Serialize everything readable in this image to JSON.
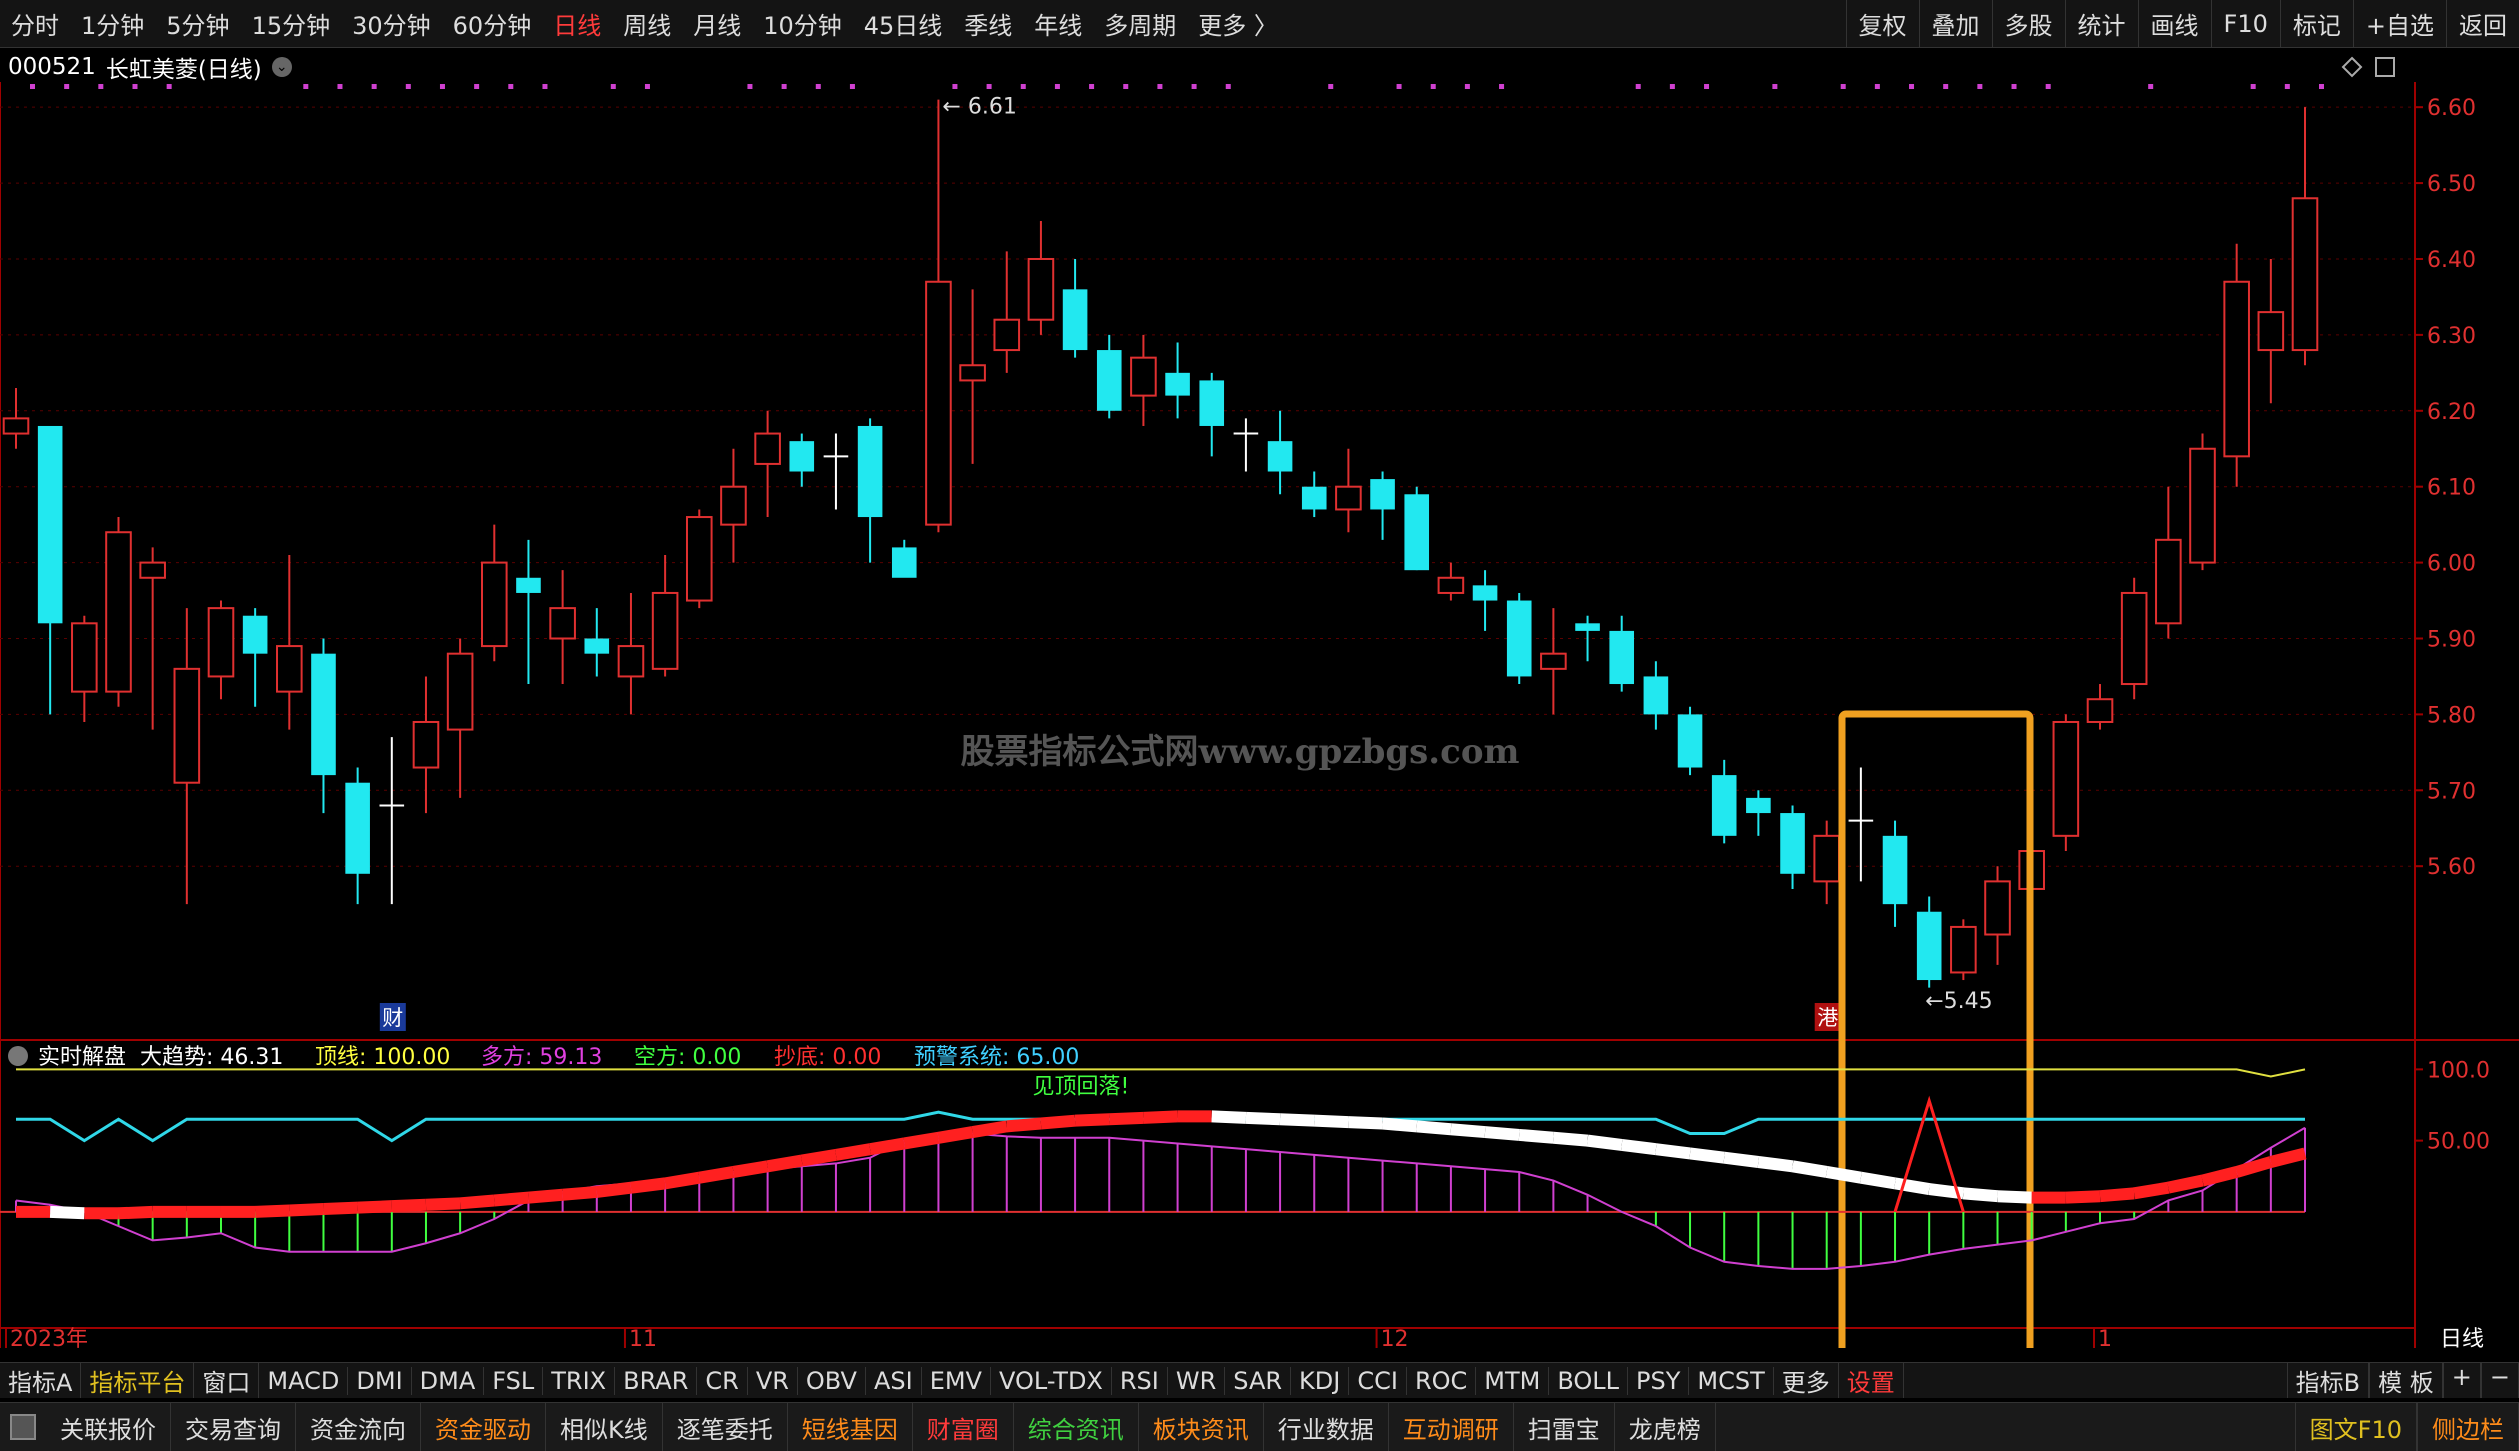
{
  "topbar": {
    "periods": [
      "分时",
      "1分钟",
      "5分钟",
      "15分钟",
      "30分钟",
      "60分钟",
      "日线",
      "周线",
      "月线",
      "10分钟",
      "45日线",
      "季线",
      "年线",
      "多周期",
      "更多 〉"
    ],
    "active_index": 6,
    "right_items": [
      "复权",
      "叠加",
      "多股",
      "统计",
      "画线",
      "F10",
      "标记",
      "+自选",
      "返回"
    ]
  },
  "stock": {
    "code": "000521",
    "name": "长虹美菱(日线)"
  },
  "watermark": "股票指标公式网www.gpzbgs.com",
  "chart_data": {
    "type": "candlestick",
    "y_ticks": [
      5.6,
      5.7,
      5.8,
      5.9,
      6.0,
      6.1,
      6.2,
      6.3,
      6.4,
      6.5,
      6.6
    ],
    "ylim": [
      5.4,
      6.62
    ],
    "high_label": "6.61",
    "low_label": "5.45",
    "date_labels": [
      {
        "index": 0,
        "text": "2023年"
      },
      {
        "index": 18,
        "text": "11"
      },
      {
        "index": 40,
        "text": "12"
      },
      {
        "index": 61,
        "text": "1"
      }
    ],
    "period_label": "日线",
    "event_markers": [
      {
        "index": 11,
        "text": "财"
      },
      {
        "index": 53,
        "text": "港"
      }
    ],
    "colors": {
      "up": "#e03030",
      "down": "#22e8f0",
      "flat": "#ffffff",
      "grid": "#5a0000"
    },
    "candles": [
      [
        6.17,
        6.19,
        6.23,
        6.15
      ],
      [
        6.18,
        5.92,
        6.18,
        5.8
      ],
      [
        5.83,
        5.92,
        5.93,
        5.79
      ],
      [
        5.83,
        6.04,
        6.06,
        5.81
      ],
      [
        5.98,
        6.0,
        6.02,
        5.78
      ],
      [
        5.71,
        5.86,
        5.94,
        5.55
      ],
      [
        5.85,
        5.94,
        5.95,
        5.82
      ],
      [
        5.93,
        5.88,
        5.94,
        5.81
      ],
      [
        5.83,
        5.89,
        6.01,
        5.78
      ],
      [
        5.88,
        5.72,
        5.9,
        5.67
      ],
      [
        5.71,
        5.59,
        5.73,
        5.55
      ],
      [
        5.68,
        5.68,
        5.77,
        5.55
      ],
      [
        5.73,
        5.79,
        5.85,
        5.67
      ],
      [
        5.78,
        5.88,
        5.9,
        5.69
      ],
      [
        5.89,
        6.0,
        6.05,
        5.87
      ],
      [
        5.98,
        5.96,
        6.03,
        5.84
      ],
      [
        5.9,
        5.94,
        5.99,
        5.84
      ],
      [
        5.9,
        5.88,
        5.94,
        5.85
      ],
      [
        5.85,
        5.89,
        5.96,
        5.8
      ],
      [
        5.86,
        5.96,
        6.01,
        5.85
      ],
      [
        5.95,
        6.06,
        6.07,
        5.94
      ],
      [
        6.05,
        6.1,
        6.15,
        6.0
      ],
      [
        6.13,
        6.17,
        6.2,
        6.06
      ],
      [
        6.16,
        6.12,
        6.17,
        6.1
      ],
      [
        6.14,
        6.14,
        6.17,
        6.07
      ],
      [
        6.18,
        6.06,
        6.19,
        6.0
      ],
      [
        6.02,
        5.98,
        6.03,
        5.99
      ],
      [
        6.05,
        6.37,
        6.61,
        6.04
      ],
      [
        6.24,
        6.26,
        6.36,
        6.13
      ],
      [
        6.28,
        6.32,
        6.41,
        6.25
      ],
      [
        6.32,
        6.4,
        6.45,
        6.3
      ],
      [
        6.36,
        6.28,
        6.4,
        6.27
      ],
      [
        6.28,
        6.2,
        6.3,
        6.19
      ],
      [
        6.22,
        6.27,
        6.3,
        6.18
      ],
      [
        6.25,
        6.22,
        6.29,
        6.19
      ],
      [
        6.24,
        6.18,
        6.25,
        6.14
      ],
      [
        6.17,
        6.17,
        6.19,
        6.12
      ],
      [
        6.16,
        6.12,
        6.2,
        6.09
      ],
      [
        6.1,
        6.07,
        6.12,
        6.06
      ],
      [
        6.07,
        6.1,
        6.15,
        6.04
      ],
      [
        6.11,
        6.07,
        6.12,
        6.03
      ],
      [
        6.09,
        5.99,
        6.1,
        5.99
      ],
      [
        5.96,
        5.98,
        6.0,
        5.95
      ],
      [
        5.97,
        5.95,
        5.99,
        5.91
      ],
      [
        5.95,
        5.85,
        5.96,
        5.84
      ],
      [
        5.86,
        5.88,
        5.94,
        5.8
      ],
      [
        5.92,
        5.91,
        5.93,
        5.87
      ],
      [
        5.91,
        5.84,
        5.93,
        5.83
      ],
      [
        5.85,
        5.8,
        5.87,
        5.78
      ],
      [
        5.8,
        5.73,
        5.81,
        5.72
      ],
      [
        5.72,
        5.64,
        5.74,
        5.63
      ],
      [
        5.69,
        5.67,
        5.7,
        5.64
      ],
      [
        5.67,
        5.59,
        5.68,
        5.57
      ],
      [
        5.58,
        5.64,
        5.66,
        5.55
      ],
      [
        5.66,
        5.66,
        5.73,
        5.58
      ],
      [
        5.64,
        5.55,
        5.66,
        5.52
      ],
      [
        5.54,
        5.45,
        5.56,
        5.44
      ],
      [
        5.46,
        5.52,
        5.53,
        5.45
      ],
      [
        5.51,
        5.58,
        5.6,
        5.47
      ],
      [
        5.57,
        5.62,
        5.64,
        5.56
      ],
      [
        5.64,
        5.79,
        5.8,
        5.62
      ],
      [
        5.79,
        5.82,
        5.84,
        5.78
      ],
      [
        5.84,
        5.96,
        5.98,
        5.82
      ],
      [
        5.92,
        6.03,
        6.1,
        5.9
      ],
      [
        6.0,
        6.15,
        6.17,
        5.99
      ],
      [
        6.14,
        6.37,
        6.42,
        6.1
      ],
      [
        6.28,
        6.33,
        6.4,
        6.21
      ],
      [
        6.28,
        6.48,
        6.6,
        6.26
      ]
    ],
    "indicator": {
      "title": "实时解盘",
      "readouts": [
        {
          "label": "大趋势:",
          "value": "46.31",
          "color": "#ffffff"
        },
        {
          "label": "顶线:",
          "value": "100.00",
          "color": "#ffff40"
        },
        {
          "label": "多方:",
          "value": "59.13",
          "color": "#e040e0"
        },
        {
          "label": "空方:",
          "value": "0.00",
          "color": "#40ff40"
        },
        {
          "label": "抄底:",
          "value": "0.00",
          "color": "#ff3030"
        },
        {
          "label": "预警系统:",
          "value": "65.00",
          "color": "#40d0ff"
        }
      ],
      "y_ticks": [
        50.0,
        100.0
      ],
      "ylim": [
        -45,
        115
      ],
      "signal_text": "见顶回落!",
      "top_line": [
        100,
        100,
        100,
        100,
        100,
        100,
        100,
        100,
        100,
        100,
        100,
        100,
        100,
        100,
        100,
        100,
        100,
        100,
        100,
        100,
        100,
        100,
        100,
        100,
        100,
        100,
        100,
        100,
        100,
        100,
        100,
        100,
        100,
        100,
        100,
        100,
        100,
        100,
        100,
        100,
        100,
        100,
        100,
        100,
        100,
        100,
        100,
        100,
        100,
        100,
        100,
        100,
        100,
        100,
        100,
        100,
        100,
        100,
        100,
        100,
        100,
        100,
        100,
        100,
        100,
        100,
        95,
        100
      ],
      "warn_line": [
        65,
        65,
        50,
        65,
        50,
        65,
        65,
        65,
        65,
        65,
        65,
        50,
        65,
        65,
        65,
        65,
        65,
        65,
        65,
        65,
        65,
        65,
        65,
        65,
        65,
        65,
        65,
        70,
        65,
        65,
        65,
        65,
        65,
        65,
        65,
        65,
        65,
        65,
        65,
        65,
        65,
        65,
        65,
        65,
        65,
        65,
        65,
        65,
        65,
        55,
        55,
        65,
        65,
        65,
        65,
        65,
        65,
        65,
        65,
        65,
        65,
        65,
        65,
        65,
        65,
        65,
        65,
        65
      ],
      "osc": [
        8,
        5,
        0,
        -10,
        -20,
        -18,
        -15,
        -25,
        -28,
        -28,
        -28,
        -28,
        -22,
        -15,
        -5,
        8,
        14,
        18,
        20,
        22,
        25,
        28,
        30,
        32,
        34,
        38,
        50,
        55,
        55,
        53,
        52,
        52,
        52,
        50,
        48,
        46,
        44,
        42,
        40,
        38,
        36,
        34,
        32,
        30,
        28,
        22,
        12,
        0,
        -10,
        -25,
        -35,
        -38,
        -40,
        -40,
        -38,
        -35,
        -30,
        -26,
        -23,
        -20,
        -14,
        -8,
        -5,
        8,
        15,
        30,
        45,
        59
      ],
      "trend": [
        0,
        0,
        -1,
        -1,
        0,
        0,
        0,
        0,
        1,
        2,
        3,
        4,
        5,
        6,
        8,
        10,
        12,
        14,
        17,
        20,
        24,
        28,
        32,
        36,
        40,
        44,
        48,
        52,
        56,
        60,
        62,
        64,
        65,
        66,
        67,
        67,
        66,
        65,
        64,
        63,
        62,
        60,
        58,
        56,
        54,
        52,
        50,
        47,
        44,
        41,
        38,
        35,
        32,
        28,
        24,
        20,
        16,
        13,
        11,
        10,
        10,
        11,
        13,
        17,
        22,
        28,
        35,
        41
      ],
      "trend_up_color": "#ff2020",
      "trend_down_color": "#ffffff",
      "spike_index": 56,
      "spike_value": 78
    }
  },
  "indicator_tabs": [
    "指标A",
    "指标平台",
    "窗口",
    "MACD",
    "DMI",
    "DMA",
    "FSL",
    "TRIX",
    "BRAR",
    "CR",
    "VR",
    "OBV",
    "ASI",
    "EMV",
    "VOL-TDX",
    "RSI",
    "WR",
    "SAR",
    "KDJ",
    "CCI",
    "ROC",
    "MTM",
    "BOLL",
    "PSY",
    "MCST",
    "更多",
    "设置"
  ],
  "indicator_right": [
    "指标B",
    "模 板",
    "+",
    "−"
  ],
  "bottom_tabs": [
    "关联报价",
    "交易查询",
    "资金流向",
    "资金驱动",
    "相似K线",
    "逐笔委托",
    "短线基因",
    "财富圈",
    "综合资讯",
    "板块资讯",
    "行业数据",
    "互动调研",
    "扫雷宝",
    "龙虎榜"
  ],
  "bottom_right": [
    "图文F10",
    "侧边栏"
  ]
}
